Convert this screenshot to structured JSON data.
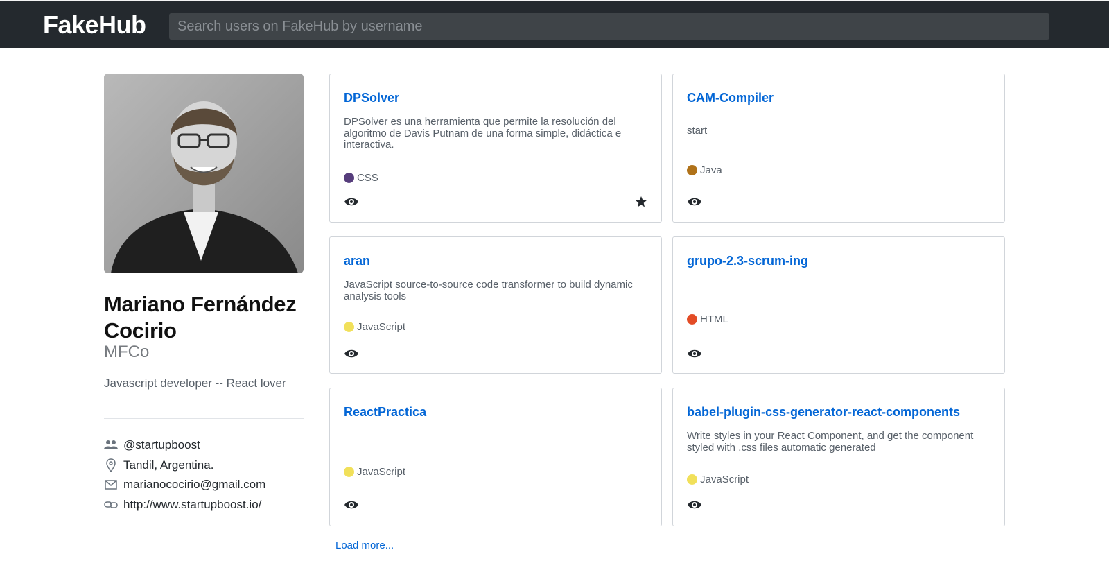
{
  "app": {
    "logo": "FakeHub"
  },
  "search": {
    "placeholder": "Search users on FakeHub by username"
  },
  "profile": {
    "name": "Mariano Fernández Cocirio",
    "login": "MFCo",
    "bio": "Javascript developer -- React lover",
    "company": "@startupboost",
    "location": "Tandil, Argentina.",
    "email": "marianococirio@gmail.com",
    "website": "http://www.startupboost.io/"
  },
  "repos": [
    {
      "name": "DPSolver",
      "description": "DPSolver es una herramienta que permite la resolución del algoritmo de Davis Putnam de una forma simple, didáctica e interactiva.",
      "language": "CSS",
      "language_color": "#563d7c",
      "starred": true
    },
    {
      "name": "CAM-Compiler",
      "description": "start",
      "language": "Java",
      "language_color": "#b07219",
      "starred": false
    },
    {
      "name": "aran",
      "description": "JavaScript source-to-source code transformer to build dynamic analysis tools",
      "language": "JavaScript",
      "language_color": "#f1e05a",
      "starred": false
    },
    {
      "name": "grupo-2.3-scrum-ing",
      "description": "",
      "language": "HTML",
      "language_color": "#e34c26",
      "starred": false
    },
    {
      "name": "ReactPractica",
      "description": "",
      "language": "JavaScript",
      "language_color": "#f1e05a",
      "starred": false
    },
    {
      "name": "babel-plugin-css-generator-react-components",
      "description": "Write styles in your React Component, and get the component styled with .css files automatic generated",
      "language": "JavaScript",
      "language_color": "#f1e05a",
      "starred": false
    }
  ],
  "load_more": "Load more...",
  "icons": {
    "company": "people-icon",
    "location": "location-pin-icon",
    "email": "mail-icon",
    "website": "link-icon",
    "watch": "eye-icon",
    "star": "star-icon"
  }
}
